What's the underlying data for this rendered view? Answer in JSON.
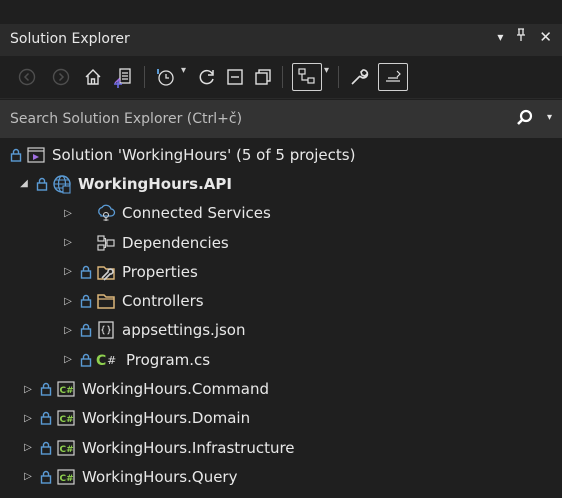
{
  "panel": {
    "title": "Solution Explorer",
    "controls": {
      "dropdown": "▾",
      "pin": "⊥",
      "close": "✕"
    }
  },
  "toolbar": {
    "buttons": [
      {
        "name": "back-icon",
        "glyph": "⊖"
      },
      {
        "name": "forward-icon",
        "glyph": "⊕"
      },
      {
        "name": "home-icon",
        "glyph": "⌂"
      },
      {
        "name": "switch-views-icon",
        "glyph": "▤"
      },
      {
        "name": "pending-changes-icon",
        "glyph": "⟲"
      },
      {
        "name": "sync-icon",
        "glyph": "↻"
      },
      {
        "name": "collapse-all-icon",
        "glyph": "⊟"
      },
      {
        "name": "show-all-files-icon",
        "glyph": "⧉"
      },
      {
        "name": "properties-icon",
        "glyph": "🔧"
      },
      {
        "name": "preview-icon",
        "glyph": "⩇"
      }
    ]
  },
  "search": {
    "placeholder": "Search Solution Explorer (Ctrl+č)"
  },
  "tree": {
    "solution": {
      "label": "Solution 'WorkingHours' (5 of 5 projects)"
    },
    "api_project": {
      "label": "WorkingHours.API"
    },
    "api_children": [
      {
        "label": "Connected Services",
        "icon": "connected-services-icon"
      },
      {
        "label": "Dependencies",
        "icon": "dependencies-icon"
      },
      {
        "label": "Properties",
        "icon": "properties-folder-icon"
      },
      {
        "label": "Controllers",
        "icon": "folder-icon"
      },
      {
        "label": "appsettings.json",
        "icon": "json-file-icon"
      },
      {
        "label": "Program.cs",
        "icon": "csharp-file-icon"
      }
    ],
    "projects": [
      {
        "label": "WorkingHours.Command"
      },
      {
        "label": "WorkingHours.Domain"
      },
      {
        "label": "WorkingHours.Infrastructure"
      },
      {
        "label": "WorkingHours.Query"
      }
    ]
  },
  "colors": {
    "background": "#1f1f1f",
    "titlebar": "#2b2b2b",
    "search": "#333333",
    "lock": "#5b9bd5",
    "csharp": "#8fd14f",
    "folder": "#dcb67a"
  }
}
